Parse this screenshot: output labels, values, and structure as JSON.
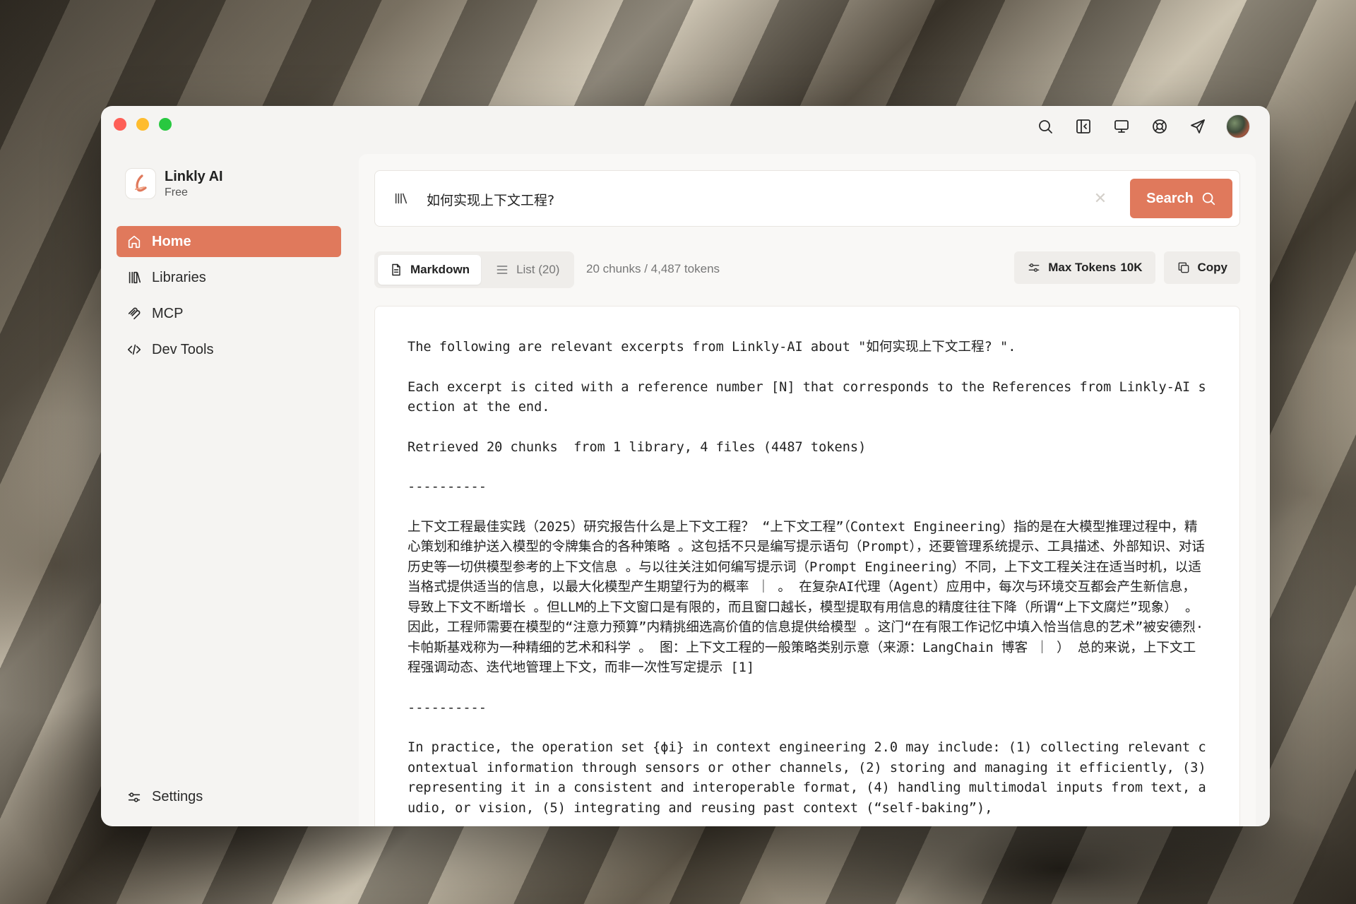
{
  "window": {
    "top_icons": [
      "search-icon",
      "sidebar-collapse-icon",
      "monitor-icon",
      "help-icon",
      "send-icon"
    ]
  },
  "brand": {
    "name": "Linkly AI",
    "plan": "Free",
    "accent": "#e0795c"
  },
  "sidebar": {
    "items": [
      {
        "label": "Home",
        "icon": "home-icon",
        "active": true
      },
      {
        "label": "Libraries",
        "icon": "library-icon",
        "active": false
      },
      {
        "label": "MCP",
        "icon": "mcp-icon",
        "active": false
      },
      {
        "label": "Dev Tools",
        "icon": "code-icon",
        "active": false
      }
    ],
    "settings_label": "Settings"
  },
  "search": {
    "query": "如何实现上下文工程?",
    "button_label": "Search"
  },
  "toolbar": {
    "tabs": [
      {
        "label": "Markdown",
        "icon": "document-icon",
        "active": true
      },
      {
        "label": "List (20)",
        "icon": "list-icon",
        "active": false
      }
    ],
    "stats": "20 chunks / 4,487 tokens",
    "max_tokens_label": "Max Tokens",
    "max_tokens_value": "10K",
    "copy_label": "Copy"
  },
  "content": {
    "paragraphs": [
      "The following are relevant excerpts from Linkly-AI about \"如何实现上下文工程? \".",
      "Each excerpt is cited with a reference number [N] that corresponds to the References from Linkly-AI section at the end.",
      "Retrieved 20 chunks  from 1 library, 4 files (4487 tokens)",
      "----------",
      "上下文工程最佳实践（2025）研究报告什么是上下文工程？ “上下文工程”（Context Engineering）指的是在大模型推理过程中，精心策划和维护送入模型的令牌集合的各种策略 。这包括不只是编写提示语句（Prompt），还要管理系统提示、工具描述、外部知识、对话历史等一切供模型参考的上下文信息 。与以往关注如何编写提示词（Prompt Engineering）不同，上下文工程关注在适当时机，以适当格式提供适当的信息，以最大化模型产生期望行为的概率 ｜ 。 在复杂AI代理（Agent）应用中，每次与环境交互都会产生新信息，导致上下文不断增长 。但LLM的上下文窗口是有限的，而且窗口越长，模型提取有用信息的精度往往下降（所谓“上下文腐烂”现象） 。因此，工程师需要在模型的“注意力预算”内精挑细选高价值的信息提供给模型 。这门“在有限工作记忆中填入恰当信息的艺术”被安德烈·卡帕斯基戏称为一种精细的艺术和科学 。 图：上下文工程的一般策略类别示意（来源：LangChain 博客 ｜ ） 总的来说，上下文工程强调动态、迭代地管理上下文，而非一次性写定提示 [1]",
      "----------",
      "In practice, the operation set {ϕi} in context engineering 2.0 may include: (1) collecting relevant contextual information through sensors or other channels, (2) storing and managing it efficiently, (3) representing it in a consistent and interoperable format, (4) handling multimodal inputs from text, audio, or vision, (5) integrating and reusing past context (“self-baking”),"
    ]
  }
}
